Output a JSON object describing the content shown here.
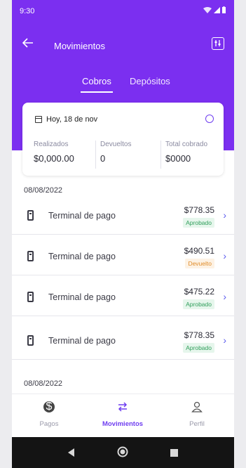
{
  "status": {
    "time": "9:30"
  },
  "header": {
    "title": "Movimientos",
    "back_icon": "arrow-left-icon",
    "filter_icon": "filter-icon"
  },
  "tabs": [
    {
      "label": "Cobros",
      "active": true
    },
    {
      "label": "Depósitos",
      "active": false
    }
  ],
  "summary": {
    "date": "Hoy, 18 de nov",
    "columns": [
      {
        "label": "Realizados",
        "value": "$0,000.00"
      },
      {
        "label": "Devueltos",
        "value": "0"
      },
      {
        "label": "Total cobrado",
        "value": "$0000"
      }
    ]
  },
  "sections": [
    {
      "date": "08/08/2022",
      "rows": [
        {
          "name": "Terminal de pago",
          "amount": "$778.35",
          "status": "Aprobado",
          "status_type": "ok"
        },
        {
          "name": "Terminal de pago",
          "amount": "$490.51",
          "status": "Devuelto",
          "status_type": "ret"
        },
        {
          "name": "Terminal de pago",
          "amount": "$475.22",
          "status": "Aprobado",
          "status_type": "ok"
        },
        {
          "name": "Terminal de pago",
          "amount": "$778.35",
          "status": "Aprobado",
          "status_type": "ok"
        }
      ]
    },
    {
      "date": "08/08/2022",
      "rows": []
    }
  ],
  "bottom_nav": [
    {
      "label": "Pagos",
      "icon": "coin-icon",
      "active": false
    },
    {
      "label": "Movimientos",
      "icon": "swap-arrows-icon",
      "active": true
    },
    {
      "label": "Perfil",
      "icon": "user-icon",
      "active": false
    }
  ],
  "colors": {
    "brand": "#7b2ff0",
    "approved": "#2f9e5a",
    "returned": "#e08c2a"
  }
}
